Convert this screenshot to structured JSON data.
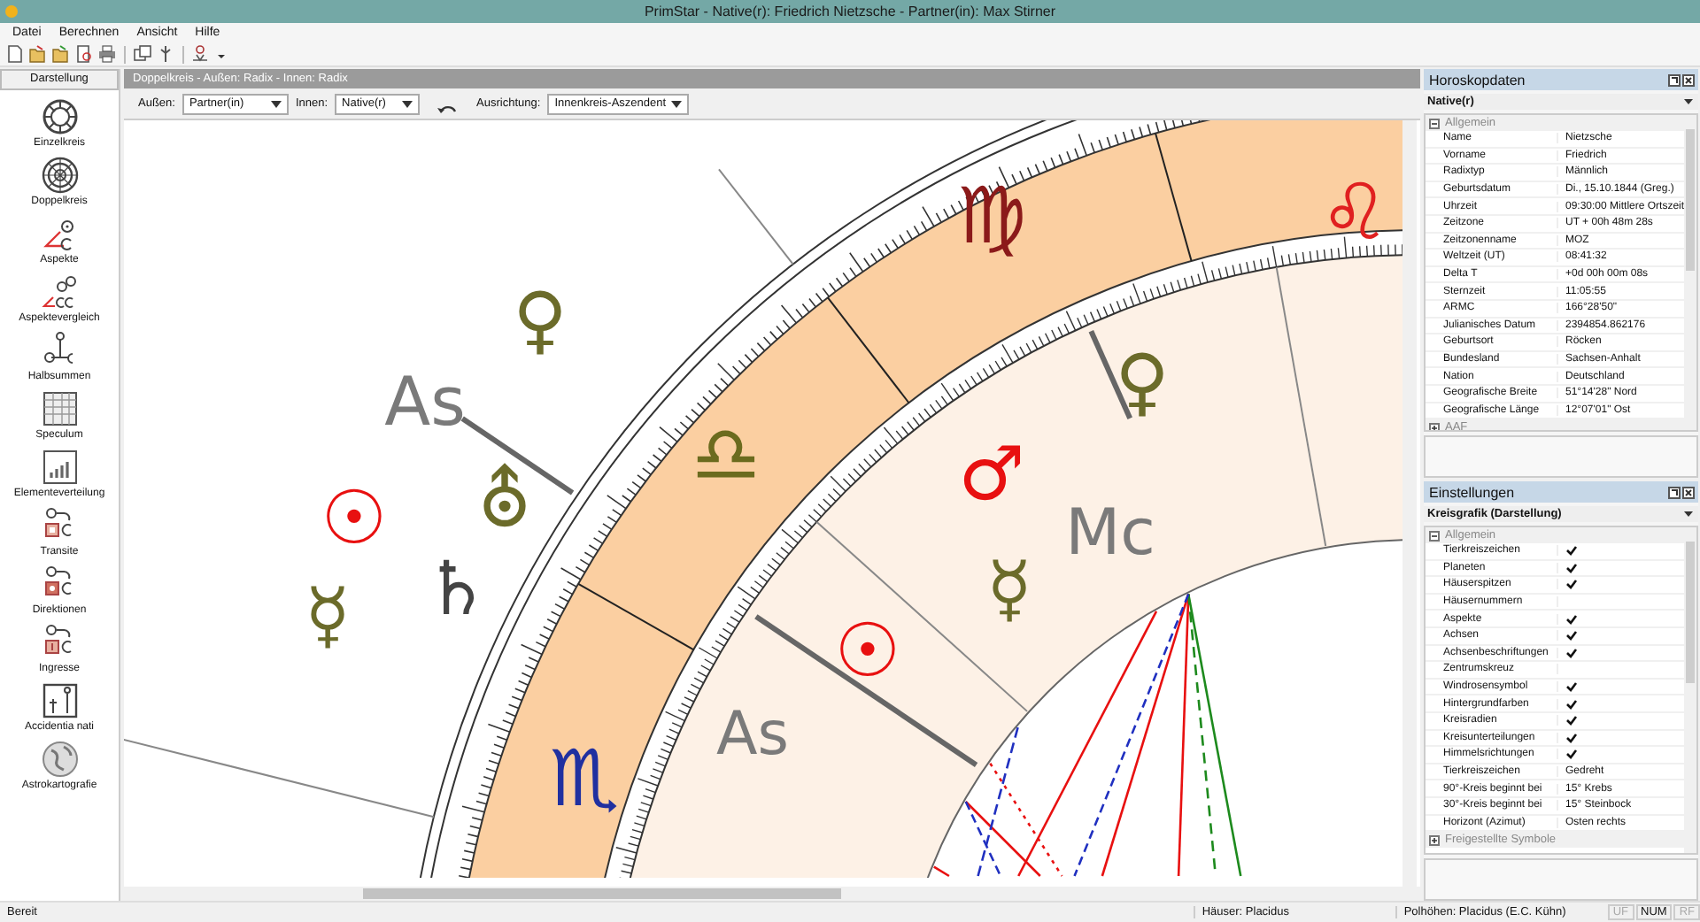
{
  "window": {
    "title": "PrimStar - Native(r): Friedrich Nietzsche - Partner(in): Max Stirner"
  },
  "menu": [
    "Datei",
    "Berechnen",
    "Ansicht",
    "Hilfe"
  ],
  "sidebar": {
    "title": "Darstellung",
    "items": [
      {
        "label": "Einzelkreis",
        "kind": "single"
      },
      {
        "label": "Doppelkreis",
        "kind": "double"
      },
      {
        "label": "Aspekte",
        "kind": "aspects"
      },
      {
        "label": "Aspektevergleich",
        "kind": "compare"
      },
      {
        "label": "Halbsummen",
        "kind": "midpoints"
      },
      {
        "label": "Speculum",
        "kind": "table"
      },
      {
        "label": "Elementeverteilung",
        "kind": "bars"
      },
      {
        "label": "Transite",
        "kind": "transit"
      },
      {
        "label": "Direktionen",
        "kind": "direction"
      },
      {
        "label": "Ingresse",
        "kind": "ingress"
      },
      {
        "label": "Accidentia nati",
        "kind": "accidentia"
      },
      {
        "label": "Astrokartografie",
        "kind": "globe"
      }
    ]
  },
  "chart_header": "Doppelkreis - Außen: Radix - Innen: Radix",
  "options": [
    {
      "kind": "select",
      "label": "Außen:",
      "value": "Partner(in)"
    },
    {
      "kind": "select",
      "label": "Innen:",
      "value": "Native(r)"
    },
    {
      "kind": "rotate"
    },
    {
      "kind": "select",
      "label": "Ausrichtung:",
      "value": "Innenkreis-Aszendent"
    }
  ],
  "chart": {
    "signs": [
      {
        "glyph": "♍",
        "color": "#8b1a1a"
      },
      {
        "glyph": "♌",
        "color": "#e02020"
      },
      {
        "glyph": "♎",
        "color": "#6b6b1e"
      },
      {
        "glyph": "♏",
        "color": "#2030a0"
      }
    ],
    "outer_planets": [
      {
        "glyph": "♀",
        "color": "#6b6b2a"
      },
      {
        "glyph": "☉",
        "color": "#e81010"
      },
      {
        "glyph": "⛢",
        "color": "#6b6b2a"
      },
      {
        "glyph": "☿",
        "color": "#6b6b2a"
      },
      {
        "glyph": "♄",
        "color": "#444444"
      }
    ],
    "inner_planets": [
      {
        "glyph": "♀",
        "color": "#6b6b2a"
      },
      {
        "glyph": "♂",
        "color": "#e81010"
      },
      {
        "glyph": "☿",
        "color": "#6b6b2a"
      },
      {
        "glyph": "☉",
        "color": "#e81010"
      }
    ],
    "axes": [
      {
        "label": "As"
      },
      {
        "label": "Mc"
      },
      {
        "label": "As"
      }
    ]
  },
  "panels": [
    {
      "title": "Horoskopdaten",
      "selector": "Native(r)",
      "sections": [
        {
          "title": "Allgemein",
          "expanded": true,
          "rows": [
            {
              "kind": "text",
              "name": "Name",
              "value": "Nietzsche"
            },
            {
              "kind": "text",
              "name": "Vorname",
              "value": "Friedrich"
            },
            {
              "kind": "text",
              "name": "Radixtyp",
              "value": "Männlich"
            },
            {
              "kind": "text",
              "name": "Geburtsdatum",
              "value": "Di., 15.10.1844 (Greg.)"
            },
            {
              "kind": "text",
              "name": "Uhrzeit",
              "value": "09:30:00 Mittlere Ortszeit"
            },
            {
              "kind": "text",
              "name": "Zeitzone",
              "value": "UT + 00h 48m 28s"
            },
            {
              "kind": "text",
              "name": "Zeitzonenname",
              "value": "MOZ"
            },
            {
              "kind": "text",
              "name": "Weltzeit (UT)",
              "value": "08:41:32"
            },
            {
              "kind": "text",
              "name": "Delta T",
              "value": "+0d 00h 00m 08s"
            },
            {
              "kind": "text",
              "name": "Sternzeit",
              "value": "11:05:55"
            },
            {
              "kind": "text",
              "name": "ARMC",
              "value": "166°28'50\""
            },
            {
              "kind": "text",
              "name": "Julianisches Datum",
              "value": "2394854.862176"
            },
            {
              "kind": "text",
              "name": "Geburtsort",
              "value": "Röcken"
            },
            {
              "kind": "text",
              "name": "Bundesland",
              "value": "Sachsen-Anhalt"
            },
            {
              "kind": "text",
              "name": "Nation",
              "value": "Deutschland"
            },
            {
              "kind": "text",
              "name": "Geografische Breite",
              "value": "51°14'28\" Nord"
            },
            {
              "kind": "text",
              "name": "Geografische Länge",
              "value": "12°07'01\" Ost"
            }
          ]
        },
        {
          "title": "AAF",
          "expanded": false
        }
      ]
    },
    {
      "title": "Einstellungen",
      "selector": "Kreisgrafik (Darstellung)",
      "sections": [
        {
          "title": "Allgemein",
          "expanded": true,
          "rows": [
            {
              "kind": "check",
              "name": "Tierkreiszeichen",
              "checked": true
            },
            {
              "kind": "check",
              "name": "Planeten",
              "checked": true
            },
            {
              "kind": "check",
              "name": "Häuserspitzen",
              "checked": true
            },
            {
              "kind": "check",
              "name": "Häusernummern",
              "checked": false
            },
            {
              "kind": "check",
              "name": "Aspekte",
              "checked": true
            },
            {
              "kind": "check",
              "name": "Achsen",
              "checked": true
            },
            {
              "kind": "check",
              "name": "Achsenbeschriftungen",
              "checked": true
            },
            {
              "kind": "check",
              "name": "Zentrumskreuz",
              "checked": false
            },
            {
              "kind": "check",
              "name": "Windrosensymbol",
              "checked": true
            },
            {
              "kind": "check",
              "name": "Hintergrundfarben",
              "checked": true
            },
            {
              "kind": "check",
              "name": "Kreisradien",
              "checked": true
            },
            {
              "kind": "check",
              "name": "Kreisunterteilungen",
              "checked": true
            },
            {
              "kind": "check",
              "name": "Himmelsrichtungen",
              "checked": true
            },
            {
              "kind": "text",
              "name": "Tierkreiszeichen",
              "value": "Gedreht"
            },
            {
              "kind": "text",
              "name": "90°-Kreis beginnt bei",
              "value": "15° Krebs"
            },
            {
              "kind": "text",
              "name": "30°-Kreis beginnt bei",
              "value": "15° Steinbock"
            },
            {
              "kind": "text",
              "name": "Horizont (Azimut)",
              "value": "Osten rechts"
            }
          ]
        },
        {
          "title": "Freigestellte Symbole",
          "expanded": false
        }
      ]
    }
  ],
  "status_bar": [
    {
      "text": "Bereit",
      "disabled": false
    },
    {
      "text": "Häuser: Placidus",
      "disabled": false
    },
    {
      "text": "Polhöhen: Placidus (E.C. Kühn)",
      "disabled": false
    },
    {
      "text": "UF",
      "disabled": true
    },
    {
      "text": "NUM",
      "disabled": false
    },
    {
      "text": "RF",
      "disabled": true
    }
  ]
}
